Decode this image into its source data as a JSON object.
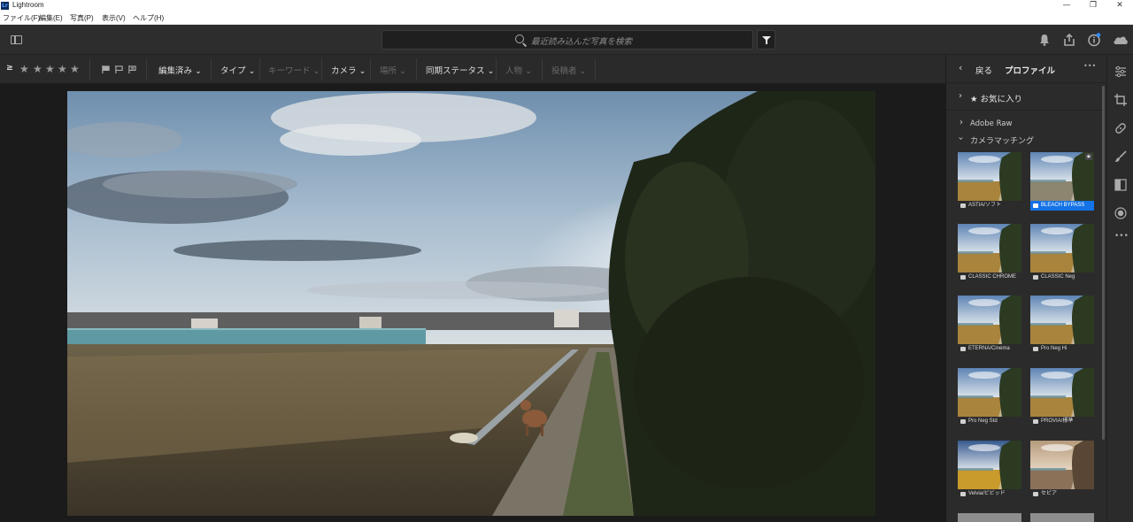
{
  "window": {
    "app_name": "Lightroom",
    "logo_text": "Lr"
  },
  "menu": {
    "items": [
      "ファイル(F)",
      "編集(E)",
      "写真(P)",
      "表示(V)",
      "ヘルプ(H)"
    ]
  },
  "topbar": {
    "search_placeholder": "最近読み込んだ写真を検索"
  },
  "filterbar": {
    "rating_operator": "≥",
    "stars": [
      "★",
      "★",
      "★",
      "★",
      "★"
    ],
    "filters": [
      {
        "label": "編集済み",
        "enabled": true
      },
      {
        "label": "タイプ",
        "enabled": true
      },
      {
        "label": "キーワード",
        "enabled": false
      },
      {
        "label": "カメラ",
        "enabled": true
      },
      {
        "label": "場所",
        "enabled": false
      },
      {
        "label": "同期ステータス",
        "enabled": true
      },
      {
        "label": "人物",
        "enabled": false
      },
      {
        "label": "投稿者",
        "enabled": false
      }
    ]
  },
  "profile_panel": {
    "back_label": "戻る",
    "title": "プロファイル",
    "more_label": "•••",
    "favorites_label": "★ お気に入り",
    "groups": [
      {
        "label": "Adobe Raw",
        "expanded": false
      },
      {
        "label": "カメラマッチング",
        "expanded": true
      }
    ],
    "profiles": [
      {
        "label": "ASTIA/ソフト",
        "selected": false
      },
      {
        "label": "BLEACH BYPASS",
        "selected": true
      },
      {
        "label": "CLASSIC CHROME",
        "selected": false
      },
      {
        "label": "CLASSIC Neg",
        "selected": false
      },
      {
        "label": "ETERNA/Cinema",
        "selected": false
      },
      {
        "label": "Pro Neg Hi",
        "selected": false
      },
      {
        "label": "Pro Neg Std",
        "selected": false
      },
      {
        "label": "PROVIA/標準",
        "selected": false
      },
      {
        "label": "Velvia/ビビッド",
        "selected": false
      },
      {
        "label": "セピア",
        "selected": false
      }
    ]
  },
  "colors": {
    "accent": "#1473e6",
    "panel_bg": "#2b2b2b",
    "viewer_bg": "#1b1b1b"
  }
}
